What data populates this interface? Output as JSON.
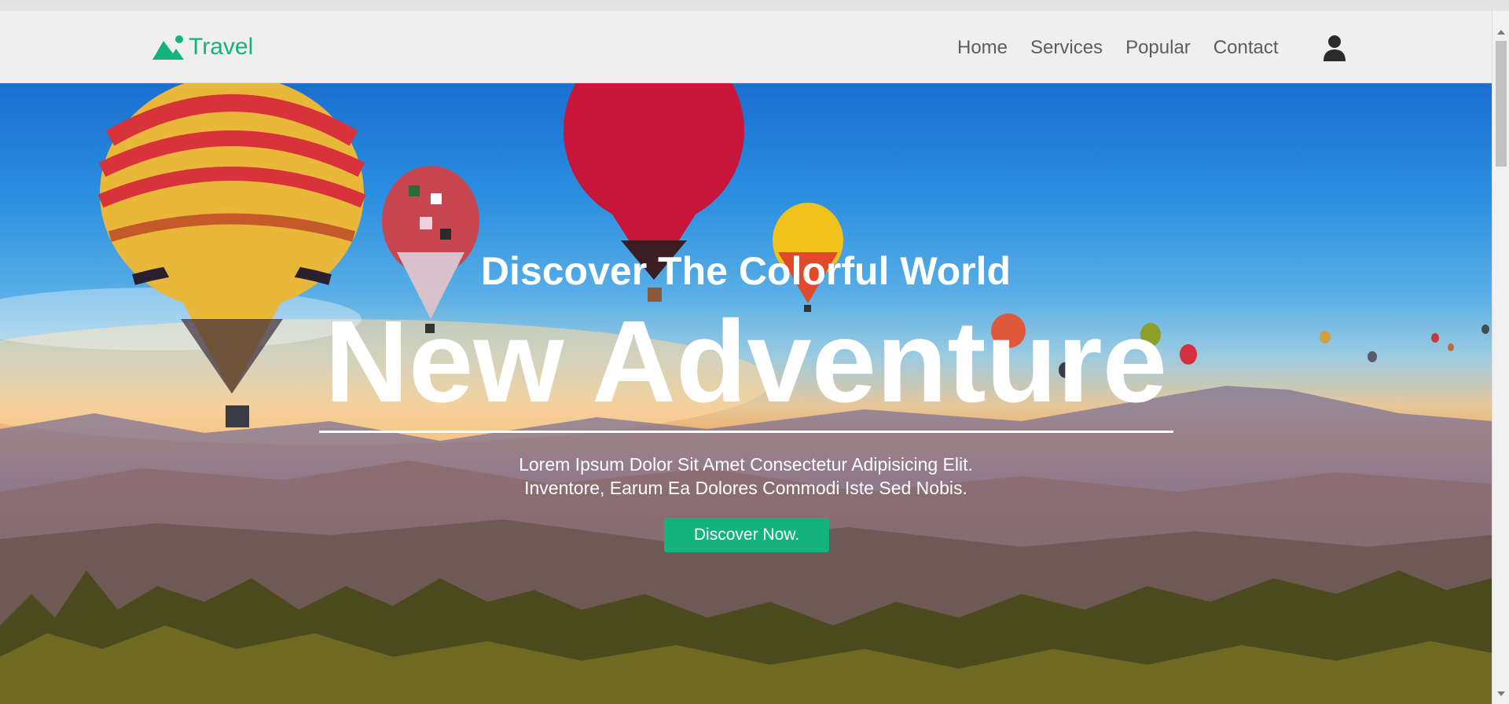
{
  "brand": {
    "name": "Travel",
    "icon": "mountain-logo-icon",
    "color": "#14b37d"
  },
  "nav": {
    "links": [
      {
        "label": "Home"
      },
      {
        "label": "Services"
      },
      {
        "label": "Popular"
      },
      {
        "label": "Contact"
      }
    ],
    "user_icon": "user-icon"
  },
  "hero": {
    "subtitle": "Discover The Colorful World",
    "title": "New Adventure",
    "text_line1": "Lorem Ipsum Dolor Sit Amet Consectetur Adipisicing Elit.",
    "text_line2": "Inventore, Earum Ea Dolores Commodi Iste Sed Nobis.",
    "button_label": "Discover Now.",
    "button_color": "#12b37c"
  }
}
